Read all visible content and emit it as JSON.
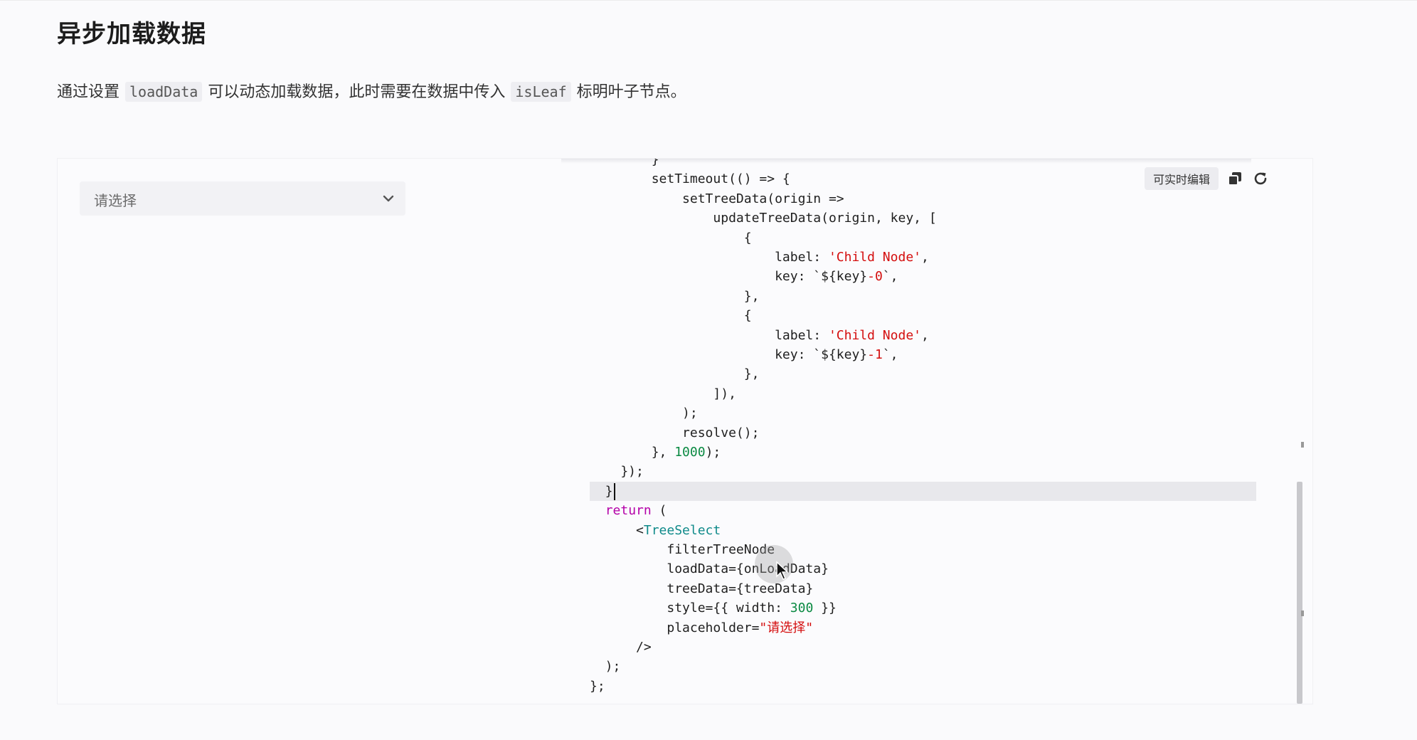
{
  "page": {
    "title": "异步加载数据",
    "description": {
      "part1": "通过设置",
      "code1": "loadData",
      "part2": "可以动态加载数据，此时需要在数据中传入",
      "code2": "isLeaf",
      "part3": "标明叶子节点。"
    }
  },
  "preview": {
    "select": {
      "placeholder": "请选择",
      "icon": "chevron-down-icon"
    }
  },
  "toolbar": {
    "edit_label": "可实时编辑",
    "copy_icon": "copy-icon",
    "reset_icon": "refresh-icon"
  },
  "code_lines": [
    {
      "tokens": [
        {
          "t": "        }",
          "c": ""
        }
      ]
    },
    {
      "tokens": [
        {
          "t": "        setTimeout(() => {",
          "c": ""
        }
      ]
    },
    {
      "tokens": [
        {
          "t": "            setTreeData(origin =>",
          "c": ""
        }
      ]
    },
    {
      "tokens": [
        {
          "t": "                updateTreeData(origin, key, [",
          "c": ""
        }
      ]
    },
    {
      "tokens": [
        {
          "t": "                    {",
          "c": ""
        }
      ]
    },
    {
      "tokens": [
        {
          "t": "                        label: ",
          "c": ""
        },
        {
          "t": "'Child Node'",
          "c": "str"
        },
        {
          "t": ",",
          "c": ""
        }
      ]
    },
    {
      "tokens": [
        {
          "t": "                        key: `${key}",
          "c": ""
        },
        {
          "t": "-0",
          "c": "str"
        },
        {
          "t": "`,",
          "c": ""
        }
      ]
    },
    {
      "tokens": [
        {
          "t": "                    },",
          "c": ""
        }
      ]
    },
    {
      "tokens": [
        {
          "t": "                    {",
          "c": ""
        }
      ]
    },
    {
      "tokens": [
        {
          "t": "                        label: ",
          "c": ""
        },
        {
          "t": "'Child Node'",
          "c": "str"
        },
        {
          "t": ",",
          "c": ""
        }
      ]
    },
    {
      "tokens": [
        {
          "t": "                        key: `${key}",
          "c": ""
        },
        {
          "t": "-1",
          "c": "str"
        },
        {
          "t": "`,",
          "c": ""
        }
      ]
    },
    {
      "tokens": [
        {
          "t": "                    },",
          "c": ""
        }
      ]
    },
    {
      "tokens": [
        {
          "t": "                ]),",
          "c": ""
        }
      ]
    },
    {
      "tokens": [
        {
          "t": "            );",
          "c": ""
        }
      ]
    },
    {
      "tokens": [
        {
          "t": "            resolve();",
          "c": ""
        }
      ]
    },
    {
      "tokens": [
        {
          "t": "        }, ",
          "c": ""
        },
        {
          "t": "1000",
          "c": "num"
        },
        {
          "t": ");",
          "c": ""
        }
      ]
    },
    {
      "tokens": [
        {
          "t": "    });",
          "c": ""
        }
      ]
    },
    {
      "tokens": [
        {
          "t": "  }",
          "c": ""
        }
      ],
      "active": true
    },
    {
      "tokens": [
        {
          "t": "  ",
          "c": ""
        },
        {
          "t": "return",
          "c": "kw"
        },
        {
          "t": " (",
          "c": ""
        }
      ]
    },
    {
      "tokens": [
        {
          "t": "      <",
          "c": ""
        },
        {
          "t": "TreeSelect",
          "c": "tag"
        }
      ]
    },
    {
      "tokens": [
        {
          "t": "          filterTreeNode",
          "c": ""
        }
      ]
    },
    {
      "tokens": [
        {
          "t": "          loadData={onLoadData}",
          "c": ""
        }
      ]
    },
    {
      "tokens": [
        {
          "t": "          treeData={treeData}",
          "c": ""
        }
      ]
    },
    {
      "tokens": [
        {
          "t": "          style={{ width: ",
          "c": ""
        },
        {
          "t": "300",
          "c": "num"
        },
        {
          "t": " }}",
          "c": ""
        }
      ]
    },
    {
      "tokens": [
        {
          "t": "          placeholder=",
          "c": ""
        },
        {
          "t": "\"请选择\"",
          "c": "str"
        }
      ]
    },
    {
      "tokens": [
        {
          "t": "      />",
          "c": ""
        }
      ]
    },
    {
      "tokens": [
        {
          "t": "  );",
          "c": ""
        }
      ]
    },
    {
      "tokens": [
        {
          "t": "};",
          "c": ""
        }
      ]
    }
  ]
}
